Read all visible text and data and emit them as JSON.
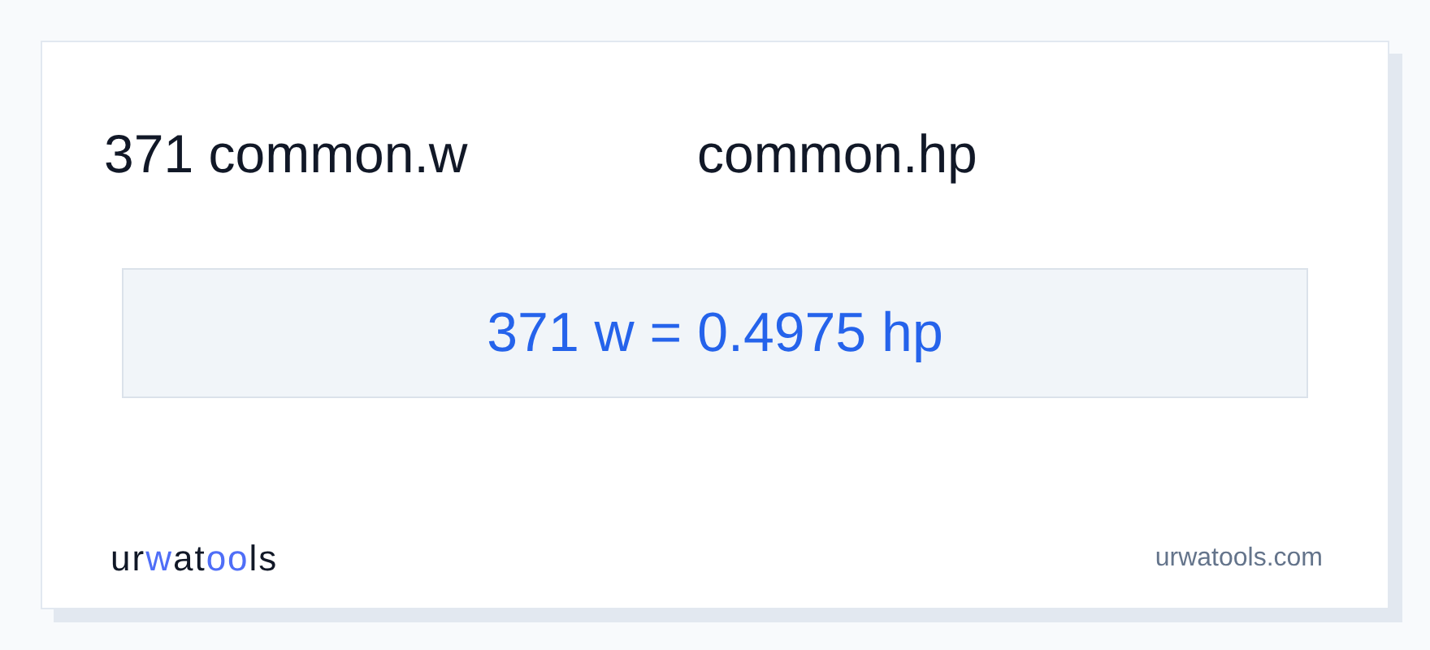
{
  "header": {
    "from_label": "371 common.w",
    "to_label": "common.hp"
  },
  "result": "371 w = 0.4975 hp",
  "footer": {
    "logo": [
      {
        "text": "ur",
        "accent": false
      },
      {
        "text": "w",
        "accent": true
      },
      {
        "text": "at",
        "accent": false
      },
      {
        "text": "oo",
        "accent": true
      },
      {
        "text": "ls",
        "accent": false
      }
    ],
    "site": "urwatools.com"
  }
}
